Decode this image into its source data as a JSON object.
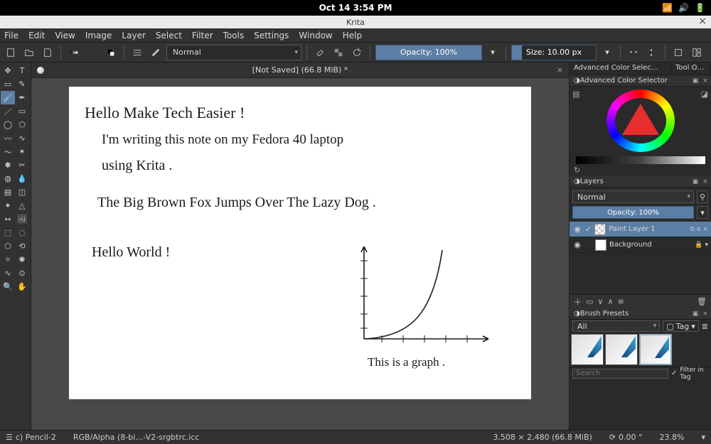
{
  "os": {
    "clock": "Oct 14   3:54 PM"
  },
  "window": {
    "title": "Krita"
  },
  "menubar": [
    "File",
    "Edit",
    "View",
    "Image",
    "Layer",
    "Select",
    "Filter",
    "Tools",
    "Settings",
    "Window",
    "Help"
  ],
  "toolbar": {
    "blend_mode": "Normal",
    "opacity_label": "Opacity: 100%",
    "size_label": "Size: 10.00 px"
  },
  "document": {
    "tab_title": "[Not Saved]  (66.8 MiB) *",
    "handwriting": {
      "l1": "Hello Make Tech Easier !",
      "l2": "I'm writing this note on my Fedora 40 laptop",
      "l3": "using Krita .",
      "l4": "The Big Brown Fox Jumps Over The Lazy Dog .",
      "l5": "Hello World !",
      "graph_caption": "This is a graph ."
    }
  },
  "dockers": {
    "acs_tab": "Advanced Color Selec…",
    "tooloptions_tab": "Tool Opti…",
    "acs_title": "Advanced Color Selector",
    "layers_title": "Layers",
    "layers_blend": "Normal",
    "layers_opacity": "Opacity:  100%",
    "layers": [
      {
        "name": "Paint Layer 1",
        "selected": true
      },
      {
        "name": "Background",
        "selected": false
      }
    ],
    "presets_title": "Brush Presets",
    "presets_filter": "All",
    "presets_tag": "Tag",
    "presets_search_placeholder": "Search",
    "presets_filter_in_tag": "Filter in Tag"
  },
  "status": {
    "brush": "c) Pencil-2",
    "profile": "RGB/Alpha (8-bi…-V2-srgbtrc.icc",
    "dims": "3,508 × 2,480 (66.8 MiB)",
    "angle": "0.00 °",
    "zoom": "23.8%"
  }
}
